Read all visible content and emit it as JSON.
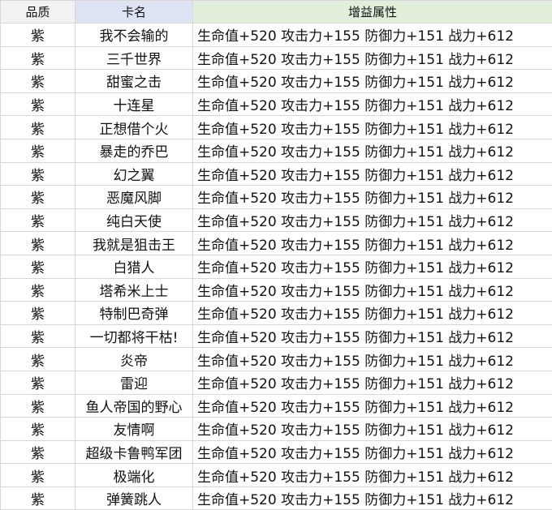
{
  "colors": {
    "header_quality_bg": "#f2f2f2",
    "header_name_bg": "#dde3f3",
    "header_attr_bg": "#e2efda",
    "grid_line": "#d7d7d7"
  },
  "table": {
    "headers": [
      "品质",
      "卡名",
      "增益属性"
    ],
    "rows": [
      {
        "quality": "紫",
        "name": "我不会输的",
        "attr": "生命值+520 攻击力+155 防御力+151 战力+612"
      },
      {
        "quality": "紫",
        "name": "三千世界",
        "attr": "生命值+520 攻击力+155 防御力+151 战力+612"
      },
      {
        "quality": "紫",
        "name": "甜蜜之击",
        "attr": "生命值+520 攻击力+155 防御力+151 战力+612"
      },
      {
        "quality": "紫",
        "name": "十连星",
        "attr": "生命值+520 攻击力+155 防御力+151 战力+612"
      },
      {
        "quality": "紫",
        "name": "正想借个火",
        "attr": "生命值+520 攻击力+155 防御力+151 战力+612"
      },
      {
        "quality": "紫",
        "name": "暴走的乔巴",
        "attr": "生命值+520 攻击力+155 防御力+151 战力+612"
      },
      {
        "quality": "紫",
        "name": "幻之翼",
        "attr": "生命值+520 攻击力+155 防御力+151 战力+612"
      },
      {
        "quality": "紫",
        "name": "恶魔风脚",
        "attr": "生命值+520 攻击力+155 防御力+151 战力+612"
      },
      {
        "quality": "紫",
        "name": "纯白天使",
        "attr": "生命值+520 攻击力+155 防御力+151 战力+612"
      },
      {
        "quality": "紫",
        "name": "我就是狙击王",
        "attr": "生命值+520 攻击力+155 防御力+151 战力+612"
      },
      {
        "quality": "紫",
        "name": "白猎人",
        "attr": "生命值+520 攻击力+155 防御力+151 战力+612"
      },
      {
        "quality": "紫",
        "name": "塔希米上士",
        "attr": "生命值+520 攻击力+155 防御力+151 战力+612"
      },
      {
        "quality": "紫",
        "name": "特制巴奇弹",
        "attr": "生命值+520 攻击力+155 防御力+151 战力+612"
      },
      {
        "quality": "紫",
        "name": "一切都将干枯!",
        "attr": "生命值+520 攻击力+155 防御力+151 战力+612"
      },
      {
        "quality": "紫",
        "name": "炎帝",
        "attr": "生命值+520 攻击力+155 防御力+151 战力+612"
      },
      {
        "quality": "紫",
        "name": "雷迎",
        "attr": "生命值+520 攻击力+155 防御力+151 战力+612"
      },
      {
        "quality": "紫",
        "name": "鱼人帝国的野心",
        "attr": "生命值+520 攻击力+155 防御力+151 战力+612"
      },
      {
        "quality": "紫",
        "name": "友情啊",
        "attr": "生命值+520 攻击力+155 防御力+151 战力+612"
      },
      {
        "quality": "紫",
        "name": "超级卡鲁鸭军团",
        "attr": "生命值+520 攻击力+155 防御力+151 战力+612"
      },
      {
        "quality": "紫",
        "name": "极端化",
        "attr": "生命值+520 攻击力+155 防御力+151 战力+612"
      },
      {
        "quality": "紫",
        "name": "弹簧跳人",
        "attr": "生命值+520 攻击力+155 防御力+151 战力+612"
      }
    ]
  }
}
